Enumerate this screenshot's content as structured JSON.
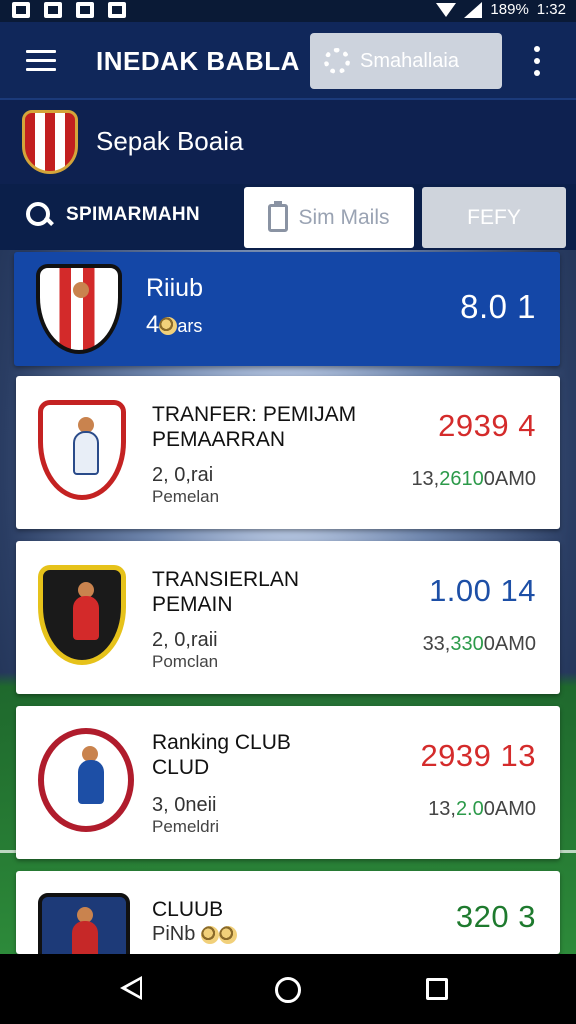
{
  "status_bar": {
    "battery": "189%",
    "time": "1:32"
  },
  "app_bar": {
    "title": "INEDAK BABLA",
    "search_placeholder": "Smahallaia",
    "menu_icon": "hamburger-icon",
    "overflow_icon": "more-vert-icon"
  },
  "league": {
    "name": "Sepak Boaia"
  },
  "filter_row": {
    "search_label": "SPIMARMAHN",
    "button_primary": "Sim Mails",
    "button_secondary": "FEFY"
  },
  "featured": {
    "title": "Riiub",
    "sub": "4",
    "sub_small": "ars",
    "score": "8.0 1"
  },
  "cards": [
    {
      "title_line1": "TRANFER: PEMIJAM",
      "title_line2": "PEMAARRAN",
      "sub_line1": "2, 0,rai",
      "sub_line2": "Pemelan",
      "score": "2939 4",
      "score_color": "#d42b2b",
      "meta_prefix": "13,",
      "meta_green": "2610",
      "meta_suffix": "0AM0"
    },
    {
      "title_line1": "TRANSIERLAN",
      "title_line2": "PEMAIN",
      "sub_line1": "2, 0,raii",
      "sub_line2": "Pomclan",
      "score": "1.00 14",
      "score_color": "#1d4fa6",
      "meta_prefix": "33,",
      "meta_green": "330",
      "meta_suffix": "0AM0"
    },
    {
      "title_line1": "Ranking CLUB",
      "title_line2": "CLUD",
      "sub_line1": "3, 0neii",
      "sub_line2": "Pemeldri",
      "score": "2939 13",
      "score_color": "#d42b2b",
      "meta_prefix": "13,",
      "meta_green": "2.0",
      "meta_suffix": "0AM0"
    },
    {
      "title_line1": "CLUUB",
      "title_line2": "",
      "sub_line1": "PiNb",
      "sub_line2": "",
      "score": "320 3",
      "score_color": "#1e7a2e",
      "meta_prefix": "",
      "meta_green": "",
      "meta_suffix": ""
    }
  ],
  "colors": {
    "appbar": "#10275a",
    "featured": "#1447a7",
    "red": "#d42b2b",
    "blue": "#1d4fa6",
    "green": "#1e7a2e"
  }
}
